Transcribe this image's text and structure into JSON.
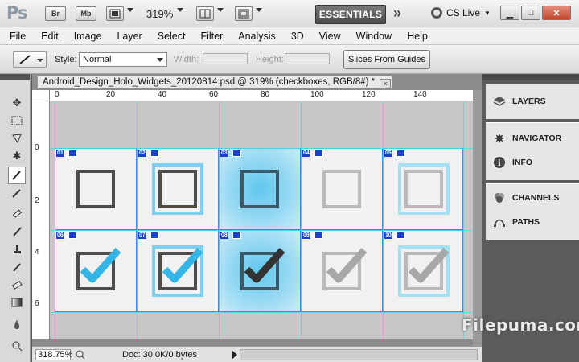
{
  "appbar": {
    "logo": "Ps",
    "bridge_btn": "Br",
    "minibridge_btn": "Mb",
    "zoom": "319%",
    "workspace": "ESSENTIALS",
    "cs_live": "CS Live",
    "icons": [
      "film-icon",
      "arrange-icon",
      "screen-mode-icon",
      "chevron-icon",
      "cs-live-icon"
    ]
  },
  "menu": [
    "File",
    "Edit",
    "Image",
    "Layer",
    "Select",
    "Filter",
    "Analysis",
    "3D",
    "View",
    "Window",
    "Help"
  ],
  "options": {
    "style_label": "Style:",
    "style_value": "Normal",
    "width_label": "Width:",
    "height_label": "Height:",
    "slices_button": "Slices From Guides"
  },
  "document": {
    "tab_title": "Android_Design_Holo_Widgets_20120814.psd @ 319% (checkboxes, RGB/8#) *",
    "close": "×",
    "ruler_h": [
      "0",
      "20",
      "40",
      "60",
      "80",
      "100",
      "120",
      "140"
    ],
    "ruler_v": [
      "0",
      "2",
      "4",
      "6"
    ],
    "slices": [
      {
        "num": "01",
        "state": "unchecked-normal"
      },
      {
        "num": "02",
        "state": "unchecked-focused"
      },
      {
        "num": "03",
        "state": "unchecked-pressed"
      },
      {
        "num": "04",
        "state": "unchecked-disabled"
      },
      {
        "num": "05",
        "state": "unchecked-disabled-focused"
      },
      {
        "num": "06",
        "state": "checked-normal"
      },
      {
        "num": "07",
        "state": "checked-focused"
      },
      {
        "num": "08",
        "state": "checked-pressed"
      },
      {
        "num": "09",
        "state": "checked-disabled"
      },
      {
        "num": "10",
        "state": "checked-disabled-focused"
      }
    ]
  },
  "status": {
    "zoom": "318.75%",
    "doc": "Doc: 30.0K/0 bytes"
  },
  "panels": {
    "group1": [
      "LAYERS"
    ],
    "group2": [
      "NAVIGATOR",
      "INFO"
    ],
    "group3": [
      "CHANNELS",
      "PATHS"
    ]
  },
  "watermark": "Filepuma.com",
  "colors": {
    "holo_blue": "#33b5e5",
    "check_dark": "#333333",
    "check_disabled": "#a8a8a8",
    "slice_label": "#1a3fc8",
    "guide": "#3fe0e0"
  }
}
